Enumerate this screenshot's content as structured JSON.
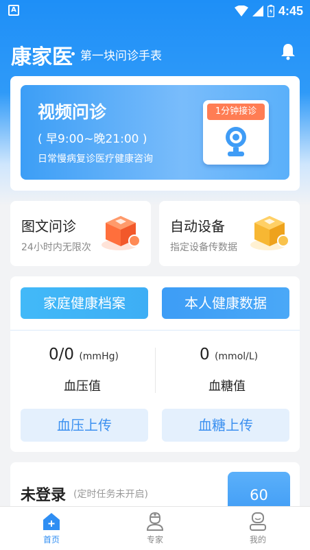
{
  "status_bar": {
    "time": "4:45",
    "app_indicator": "A"
  },
  "header": {
    "logo": "康家医",
    "tagline": "第一块问诊手表",
    "icon": "bell-icon"
  },
  "video_consult": {
    "title": "视频问诊",
    "hours": "( 早9:00~晚21:00 )",
    "description": "日常慢病复诊医疗健康咨询",
    "badge": "1分钟接诊",
    "icon": "camera-icon"
  },
  "quick_cards": [
    {
      "title": "图文问诊",
      "subtitle": "24小时内无限次",
      "icon": "orange-cube-icon",
      "color": "#ff6f3c"
    },
    {
      "title": "自动设备",
      "subtitle": "指定设备传数据",
      "icon": "yellow-cube-icon",
      "color": "#f7b733"
    }
  ],
  "health": {
    "family_records_label": "家庭健康档案",
    "personal_data_label": "本人健康数据",
    "blood_pressure": {
      "value": "0/0",
      "unit": "(mmHg)",
      "label": "血压值",
      "upload_label": "血压上传"
    },
    "blood_sugar": {
      "value": "0",
      "unit": "(mmol/L)",
      "label": "血糖值",
      "upload_label": "血糖上传"
    }
  },
  "login": {
    "title": "未登录",
    "subtitle": "(定时任务未开启)",
    "count": "60"
  },
  "bottom_nav": [
    {
      "label": "首页",
      "icon": "home-icon",
      "active": true
    },
    {
      "label": "专家",
      "icon": "doctor-icon",
      "active": false
    },
    {
      "label": "我的",
      "icon": "profile-icon",
      "active": false
    }
  ],
  "colors": {
    "primary": "#2f8ef3",
    "accent": "#ff7d54"
  }
}
